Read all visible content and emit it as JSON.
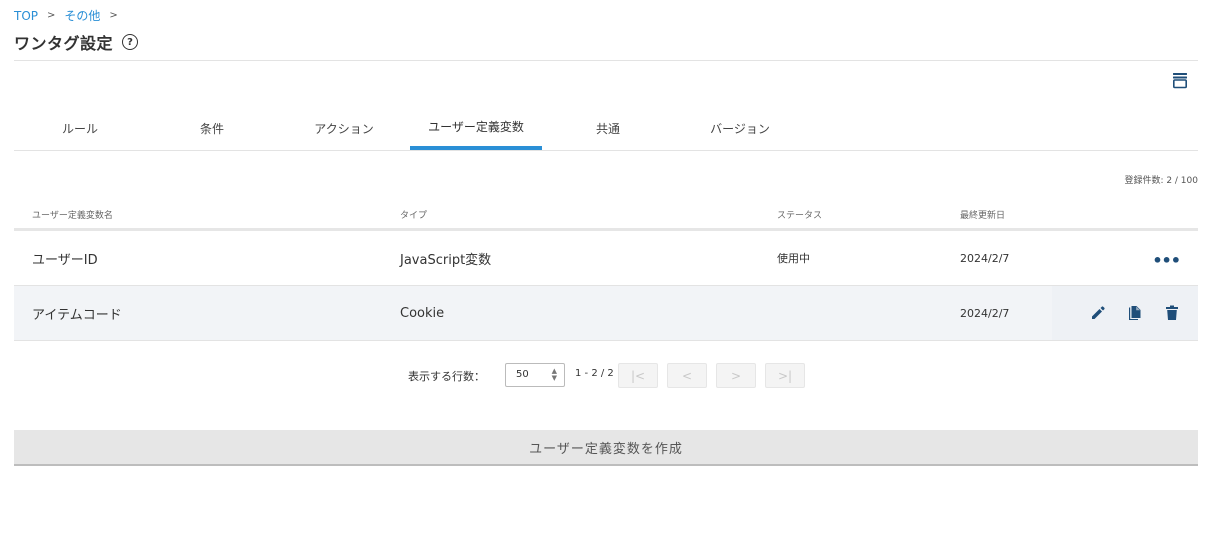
{
  "breadcrumb": {
    "items": [
      "TOP",
      "その他"
    ],
    "separator": ">"
  },
  "page": {
    "title": "ワンタグ設定",
    "help": "?"
  },
  "tabs": [
    {
      "label": "ルール"
    },
    {
      "label": "条件"
    },
    {
      "label": "アクション"
    },
    {
      "label": "ユーザー定義変数",
      "active": true
    },
    {
      "label": "共通"
    },
    {
      "label": "バージョン"
    }
  ],
  "registration_count": "登録件数: 2 / 100",
  "table": {
    "headers": {
      "name": "ユーザー定義変数名",
      "type": "タイプ",
      "status": "ステータス",
      "updated": "最終更新日"
    },
    "rows": [
      {
        "name": "ユーザーID",
        "type": "JavaScript変数",
        "status": "使用中",
        "updated": "2024/2/7",
        "actions": "more-icon"
      },
      {
        "name": "アイテムコード",
        "type": "Cookie",
        "status": "",
        "updated": "2024/2/7",
        "actions": "edit-copy-delete"
      }
    ],
    "more_label": "•••"
  },
  "pagination": {
    "rows_label": "表示する行数：",
    "rows_value": "50",
    "range": "1 - 2 / 2",
    "first": "|<",
    "prev": "<",
    "next": ">",
    "last": ">|"
  },
  "create_button": "ユーザー定義変数を作成",
  "colors": {
    "accent": "#2a8fd6",
    "icon": "#1f4e79"
  }
}
